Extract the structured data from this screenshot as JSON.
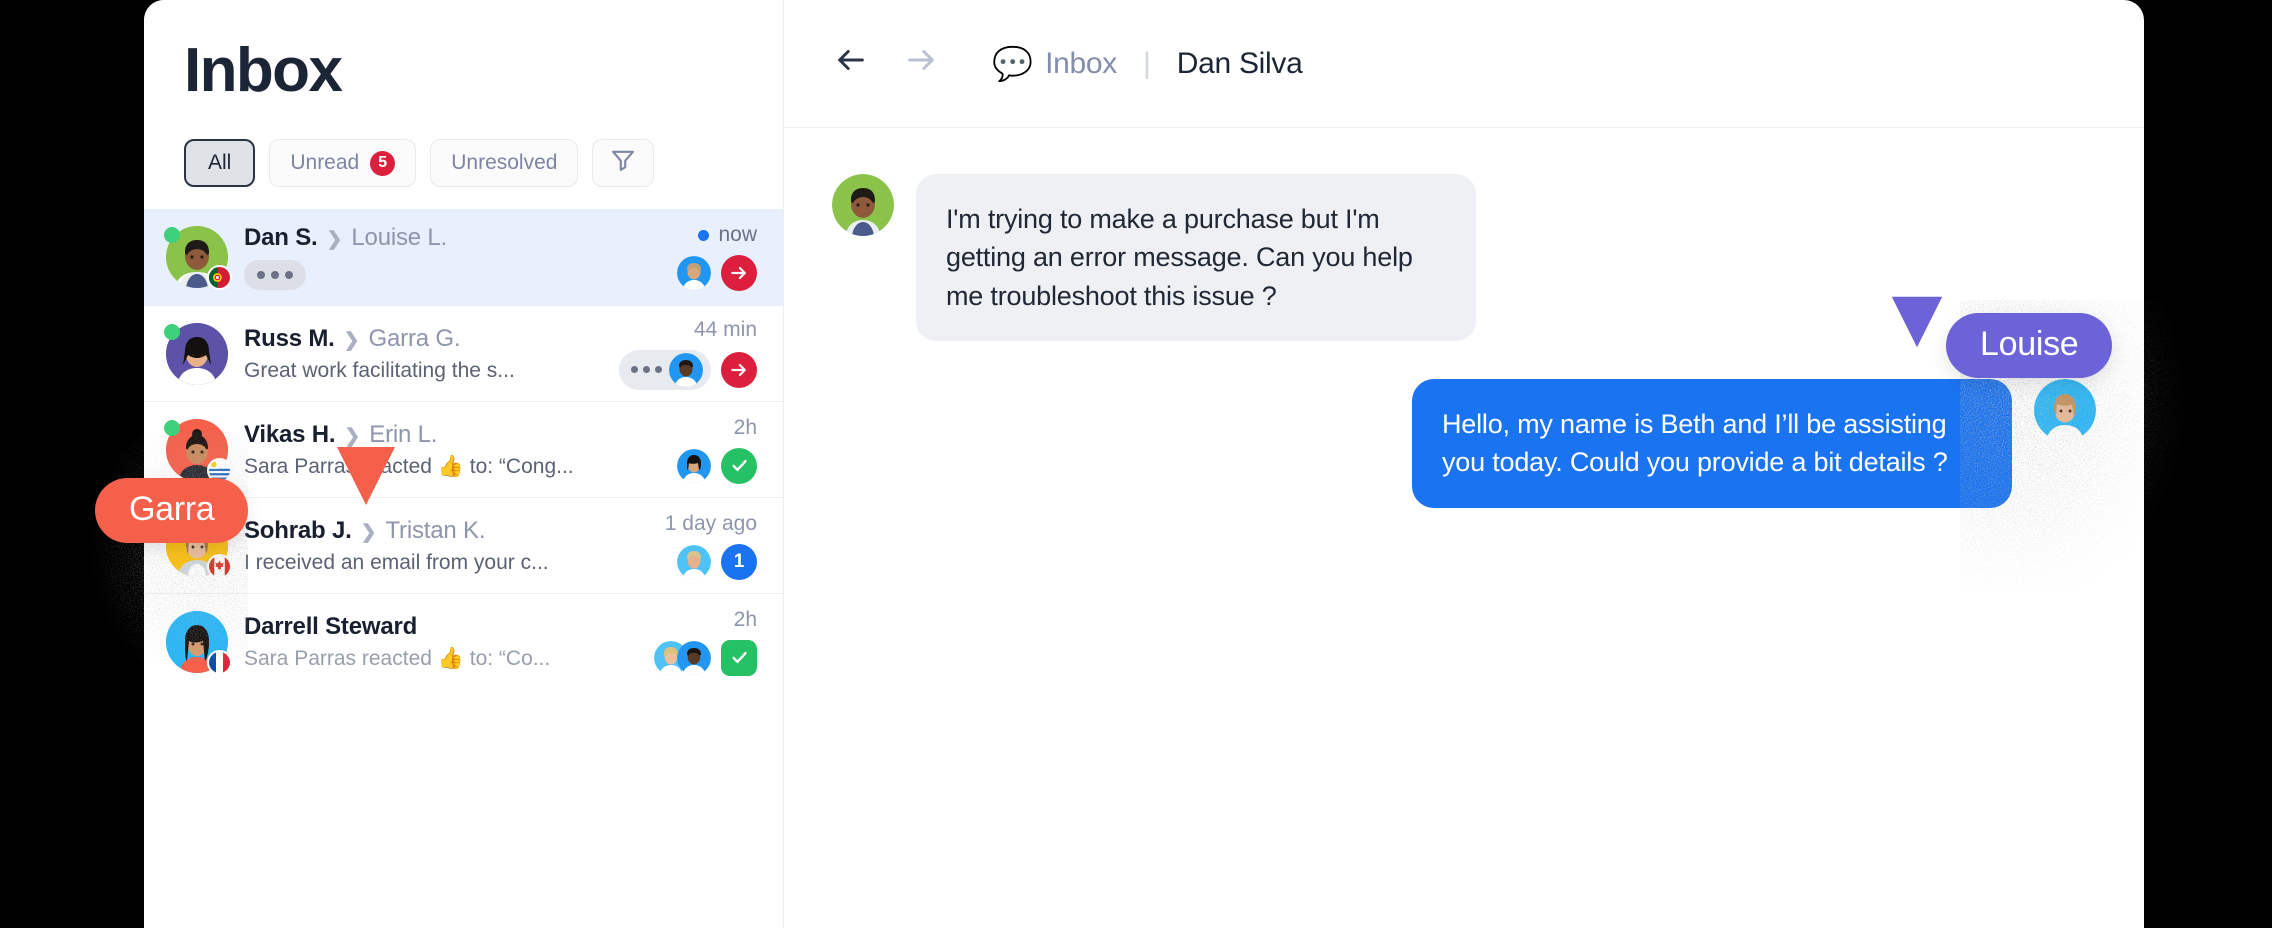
{
  "app": {
    "background": "#000000",
    "accent_blue": "#1a73f0",
    "accent_red": "#dc1f3c",
    "accent_green": "#26c165"
  },
  "inbox": {
    "title": "Inbox",
    "filters": [
      {
        "label": "All",
        "active": true,
        "badge": null
      },
      {
        "label": "Unread",
        "active": false,
        "badge": "5"
      },
      {
        "label": "Unresolved",
        "active": false,
        "badge": null
      }
    ],
    "filter_icon": "funnel-icon",
    "conversations": [
      {
        "from": "Dan S.",
        "to": "Louise L.",
        "preview": null,
        "typing": true,
        "time": "now",
        "unread_dot": true,
        "selected": true,
        "flag": "portugal",
        "online": true,
        "avatar_bg": "#8bc34a",
        "avatar_hair": "#1d1a18",
        "avatar_skin": "#8d5a3b",
        "mini_avatars": [
          {
            "bg": "#2196f3",
            "hair": "#c4a078",
            "skin": "#d8a87c"
          }
        ],
        "action": {
          "type": "arrow",
          "color": "red",
          "glyph": "→"
        }
      },
      {
        "from": "Russ M.",
        "to": "Garra G.",
        "preview": "Great work facilitating the s...",
        "typing": false,
        "time": "44 min",
        "unread_dot": false,
        "selected": false,
        "flag": null,
        "online": true,
        "avatar_bg": "#5c53a8",
        "avatar_hair": "#14100f",
        "avatar_skin": "#e8b18c",
        "stack_dots": true,
        "mini_avatars": [
          {
            "bg": "#2196f3",
            "hair": "#20160f",
            "skin": "#5a3a24"
          }
        ],
        "action": {
          "type": "arrow",
          "color": "red",
          "glyph": "→"
        }
      },
      {
        "from": "Vikas H.",
        "to": "Erin L.",
        "preview": "Sara Parras reacted 👍 to: “Cong...",
        "typing": false,
        "time": "2h",
        "unread_dot": false,
        "selected": false,
        "flag": "uruguay",
        "online": true,
        "avatar_bg": "#f4604a",
        "avatar_hair": "#1d1512",
        "avatar_skin": "#c98a5e",
        "mini_avatars": [
          {
            "bg": "#2196f3",
            "hair": "#171210",
            "skin": "#d8a87c"
          }
        ],
        "action": {
          "type": "check",
          "color": "green",
          "glyph": "✓"
        }
      },
      {
        "from": "Sohrab J.",
        "to": "Tristan K.",
        "preview": "I received an email from your c...",
        "typing": false,
        "time": "1 day ago",
        "unread_dot": false,
        "selected": false,
        "flag": "canada",
        "online": true,
        "avatar_bg": "#ffc107",
        "avatar_hair": "#a9713c",
        "avatar_skin": "#f0c09a",
        "mini_avatars": [
          {
            "bg": "#4fc3f7",
            "hair": "#d9c48a",
            "skin": "#e8b18c"
          }
        ],
        "action": {
          "type": "count",
          "color": "blue",
          "glyph": "1"
        }
      },
      {
        "from": "Darrell Steward",
        "to": null,
        "preview": "Sara Parras reacted 👍 to: “Co...",
        "typing": false,
        "time": "2h",
        "unread_dot": false,
        "selected": false,
        "flag": "france",
        "online": false,
        "avatar_bg": "#29b6f6",
        "avatar_hair": "#161210",
        "avatar_skin": "#d79a6e",
        "mini_avatars": [
          {
            "bg": "#4fc3f7",
            "hair": "#e0c27f",
            "skin": "#f0c09a"
          },
          {
            "bg": "#2196f3",
            "hair": "#1a1310",
            "skin": "#5a3a24"
          }
        ],
        "action": {
          "type": "check-square",
          "color": "green",
          "glyph": "✓"
        }
      }
    ]
  },
  "chat": {
    "nav_back_icon": "arrow-left-icon",
    "nav_forward_icon": "arrow-right-icon",
    "breadcrumb_emoji": "💬",
    "breadcrumb_inbox": "Inbox",
    "breadcrumb_sep": "|",
    "contact_name": "Dan Silva",
    "messages": [
      {
        "direction": "in",
        "text": "I'm trying to make a purchase but I'm getting an error message. Can you help me troubleshoot this issue ?",
        "avatar_bg": "#8bc34a",
        "avatar_hair": "#1d1a18",
        "avatar_skin": "#8d5a3b"
      },
      {
        "direction": "out",
        "text": "Hello, my name is Beth and I’ll be assisting you today. Could you provide a bit details ?",
        "avatar_bg": "#29b6f6",
        "avatar_hair": "#c4905c",
        "avatar_skin": "#e8b894"
      }
    ]
  },
  "cursors": [
    {
      "name": "Garra",
      "color": "#f4604a",
      "text_color": "#ffffff"
    },
    {
      "name": "Louise",
      "color": "#6c63d8",
      "text_color": "#ffffff"
    }
  ]
}
